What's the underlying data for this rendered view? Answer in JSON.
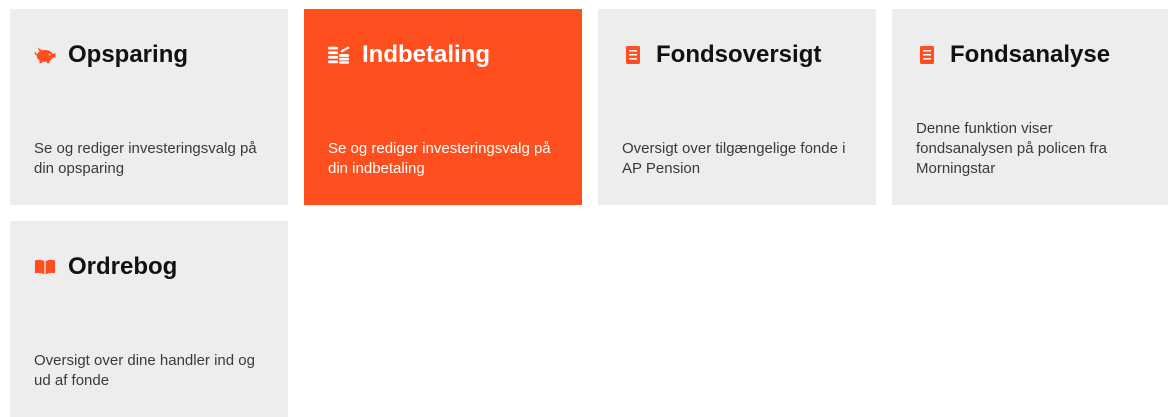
{
  "colors": {
    "accent": "#ff4f1f",
    "tile_background": "#ededed",
    "icon": "#ff4f1f",
    "active_text": "#ffffff"
  },
  "tiles": [
    {
      "title": "Opsparing",
      "description": "Se og rediger investeringsvalg på din opsparing",
      "icon": "piggy-bank-icon",
      "active": false
    },
    {
      "title": "Indbetaling",
      "description": "Se og rediger investeringsvalg på din indbetaling",
      "icon": "coins-stack-icon",
      "active": true
    },
    {
      "title": "Fondsoversigt",
      "description": "Oversigt over tilgængelige fonde i AP Pension",
      "icon": "document-icon",
      "active": false
    },
    {
      "title": "Fondsanalyse",
      "description": "Denne funktion viser fondsanalysen på policen fra Morningstar",
      "icon": "document-icon",
      "active": false
    },
    {
      "title": "Ordrebog",
      "description": "Oversigt over dine handler ind og ud af fonde",
      "icon": "open-book-icon",
      "active": false
    }
  ]
}
